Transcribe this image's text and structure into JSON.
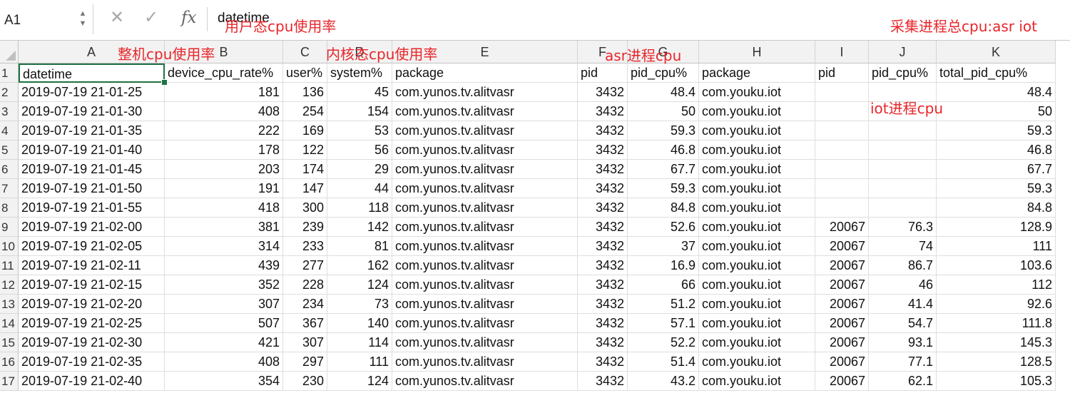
{
  "formula_bar": {
    "name_box": "A1",
    "fx_label": "fx",
    "formula": "datetime"
  },
  "columns": [
    {
      "letter": "A"
    },
    {
      "letter": "B"
    },
    {
      "letter": "C"
    },
    {
      "letter": "D"
    },
    {
      "letter": "E"
    },
    {
      "letter": "F"
    },
    {
      "letter": "G"
    },
    {
      "letter": "H"
    },
    {
      "letter": "I"
    },
    {
      "letter": "J"
    },
    {
      "letter": "K"
    }
  ],
  "headers": [
    "datetime",
    "device_cpu_rate%",
    "user%",
    "system%",
    "package",
    "pid",
    "pid_cpu%",
    "package",
    "pid",
    "pid_cpu%",
    "total_pid_cpu%"
  ],
  "rows": [
    [
      "2019-07-19 21-01-25",
      "181",
      "136",
      "45",
      "com.yunos.tv.alitvasr",
      "3432",
      "48.4",
      "com.youku.iot",
      "",
      "",
      "48.4"
    ],
    [
      "2019-07-19 21-01-30",
      "408",
      "254",
      "154",
      "com.yunos.tv.alitvasr",
      "3432",
      "50",
      "com.youku.iot",
      "",
      "",
      "50"
    ],
    [
      "2019-07-19 21-01-35",
      "222",
      "169",
      "53",
      "com.yunos.tv.alitvasr",
      "3432",
      "59.3",
      "com.youku.iot",
      "",
      "",
      "59.3"
    ],
    [
      "2019-07-19 21-01-40",
      "178",
      "122",
      "56",
      "com.yunos.tv.alitvasr",
      "3432",
      "46.8",
      "com.youku.iot",
      "",
      "",
      "46.8"
    ],
    [
      "2019-07-19 21-01-45",
      "203",
      "174",
      "29",
      "com.yunos.tv.alitvasr",
      "3432",
      "67.7",
      "com.youku.iot",
      "",
      "",
      "67.7"
    ],
    [
      "2019-07-19 21-01-50",
      "191",
      "147",
      "44",
      "com.yunos.tv.alitvasr",
      "3432",
      "59.3",
      "com.youku.iot",
      "",
      "",
      "59.3"
    ],
    [
      "2019-07-19 21-01-55",
      "418",
      "300",
      "118",
      "com.yunos.tv.alitvasr",
      "3432",
      "84.8",
      "com.youku.iot",
      "",
      "",
      "84.8"
    ],
    [
      "2019-07-19 21-02-00",
      "381",
      "239",
      "142",
      "com.yunos.tv.alitvasr",
      "3432",
      "52.6",
      "com.youku.iot",
      "20067",
      "76.3",
      "128.9"
    ],
    [
      "2019-07-19 21-02-05",
      "314",
      "233",
      "81",
      "com.yunos.tv.alitvasr",
      "3432",
      "37",
      "com.youku.iot",
      "20067",
      "74",
      "111"
    ],
    [
      "2019-07-19 21-02-11",
      "439",
      "277",
      "162",
      "com.yunos.tv.alitvasr",
      "3432",
      "16.9",
      "com.youku.iot",
      "20067",
      "86.7",
      "103.6"
    ],
    [
      "2019-07-19 21-02-15",
      "352",
      "228",
      "124",
      "com.yunos.tv.alitvasr",
      "3432",
      "66",
      "com.youku.iot",
      "20067",
      "46",
      "112"
    ],
    [
      "2019-07-19 21-02-20",
      "307",
      "234",
      "73",
      "com.yunos.tv.alitvasr",
      "3432",
      "51.2",
      "com.youku.iot",
      "20067",
      "41.4",
      "92.6"
    ],
    [
      "2019-07-19 21-02-25",
      "507",
      "367",
      "140",
      "com.yunos.tv.alitvasr",
      "3432",
      "57.1",
      "com.youku.iot",
      "20067",
      "54.7",
      "111.8"
    ],
    [
      "2019-07-19 21-02-30",
      "421",
      "307",
      "114",
      "com.yunos.tv.alitvasr",
      "3432",
      "52.2",
      "com.youku.iot",
      "20067",
      "93.1",
      "145.3"
    ],
    [
      "2019-07-19 21-02-35",
      "408",
      "297",
      "111",
      "com.yunos.tv.alitvasr",
      "3432",
      "51.4",
      "com.youku.iot",
      "20067",
      "77.1",
      "128.5"
    ],
    [
      "2019-07-19 21-02-40",
      "354",
      "230",
      "124",
      "com.yunos.tv.alitvasr",
      "3432",
      "43.2",
      "com.youku.iot",
      "20067",
      "62.1",
      "105.3"
    ]
  ],
  "row_numbers": [
    "1",
    "2",
    "3",
    "4",
    "5",
    "6",
    "7",
    "8",
    "9",
    "10",
    "11",
    "12",
    "13",
    "14",
    "15",
    "16",
    "17"
  ],
  "annotations": {
    "user_cpu": "用户态cpu使用率",
    "total_asr_iot": "采集进程总cpu:asr iot",
    "device_cpu": "整机cpu使用率",
    "kernel_cpu": "内核态cpu使用率",
    "asr_cpu": "asr进程cpu",
    "iot_cpu": "iot进程cpu"
  },
  "colors": {
    "annotation": "#e8262b",
    "selection": "#1f7244"
  }
}
